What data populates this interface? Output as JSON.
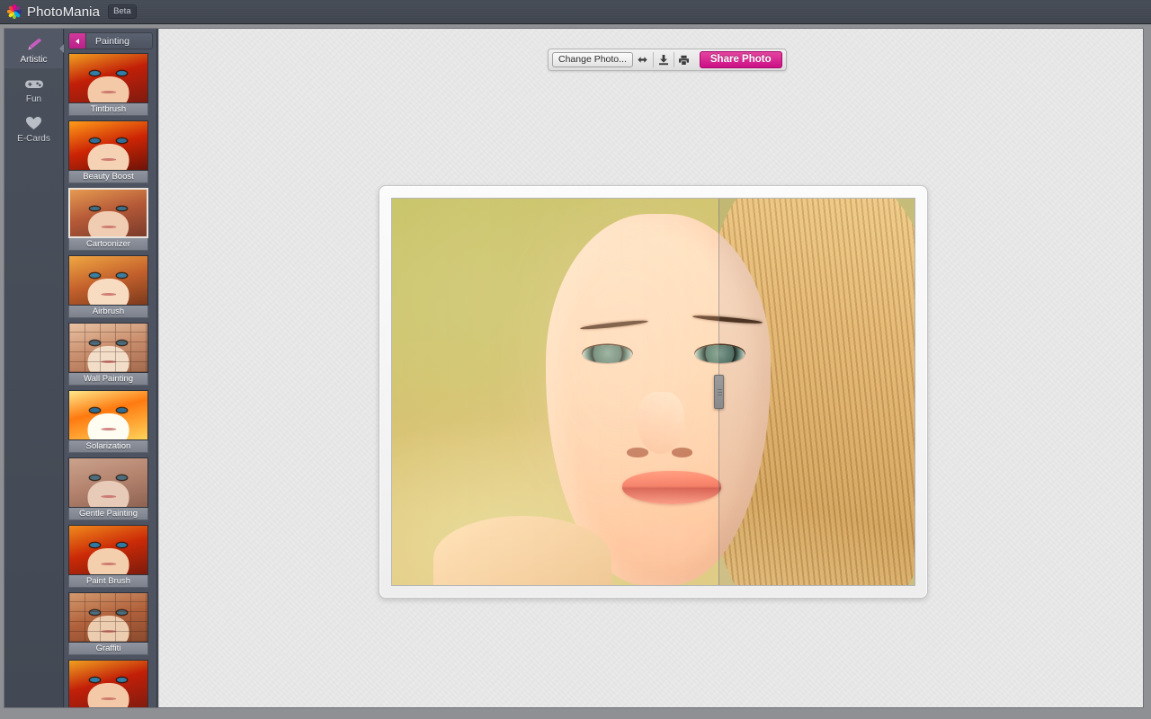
{
  "header": {
    "brand": "PhotoMania",
    "badge": "Beta",
    "logo_icon": "pinwheel-logo-icon",
    "logo_colors": [
      "#8dc63f",
      "#f7e017",
      "#f7941e",
      "#ef4136",
      "#ec008c",
      "#92278f",
      "#2e3192",
      "#00aeef"
    ],
    "background": "#454b55"
  },
  "left_nav": {
    "items": [
      {
        "label": "Artistic",
        "icon": "paintbrush-icon",
        "active": true
      },
      {
        "label": "Fun",
        "icon": "gamepad-icon",
        "active": false
      },
      {
        "label": "E-Cards",
        "icon": "heart-icon",
        "active": false
      }
    ]
  },
  "effects_panel": {
    "back_icon": "chevron-left-icon",
    "title": "Painting",
    "accent": "#c9218c",
    "effects": [
      {
        "label": "Tintbrush",
        "style": "tint",
        "selected": false
      },
      {
        "label": "Beauty Boost",
        "style": "beauty",
        "selected": false
      },
      {
        "label": "Cartoonizer",
        "style": "cartoon",
        "selected": true
      },
      {
        "label": "Airbrush",
        "style": "airbrush",
        "selected": false
      },
      {
        "label": "Wall Painting",
        "style": "brick",
        "selected": false
      },
      {
        "label": "Solarization",
        "style": "solar",
        "selected": false
      },
      {
        "label": "Gentle Painting",
        "style": "gentle",
        "selected": false
      },
      {
        "label": "Paint Brush",
        "style": "paint",
        "selected": false
      },
      {
        "label": "Graffiti",
        "style": "brick2",
        "selected": false
      },
      {
        "label": "",
        "style": "tint",
        "selected": false
      }
    ]
  },
  "toolbar": {
    "change_photo_label": "Change Photo...",
    "compare_icon": "compare-arrows-icon",
    "download_icon": "download-icon",
    "print_icon": "print-icon",
    "share_photo_label": "Share Photo",
    "share_color": "#cc0f86"
  },
  "canvas": {
    "split_position_percent": 62.5,
    "split_handle_icon": "split-drag-handle-icon",
    "photo_alt": "portrait-of-blonde-woman-with-cartoonizer-effect-applied-to-left-half"
  }
}
